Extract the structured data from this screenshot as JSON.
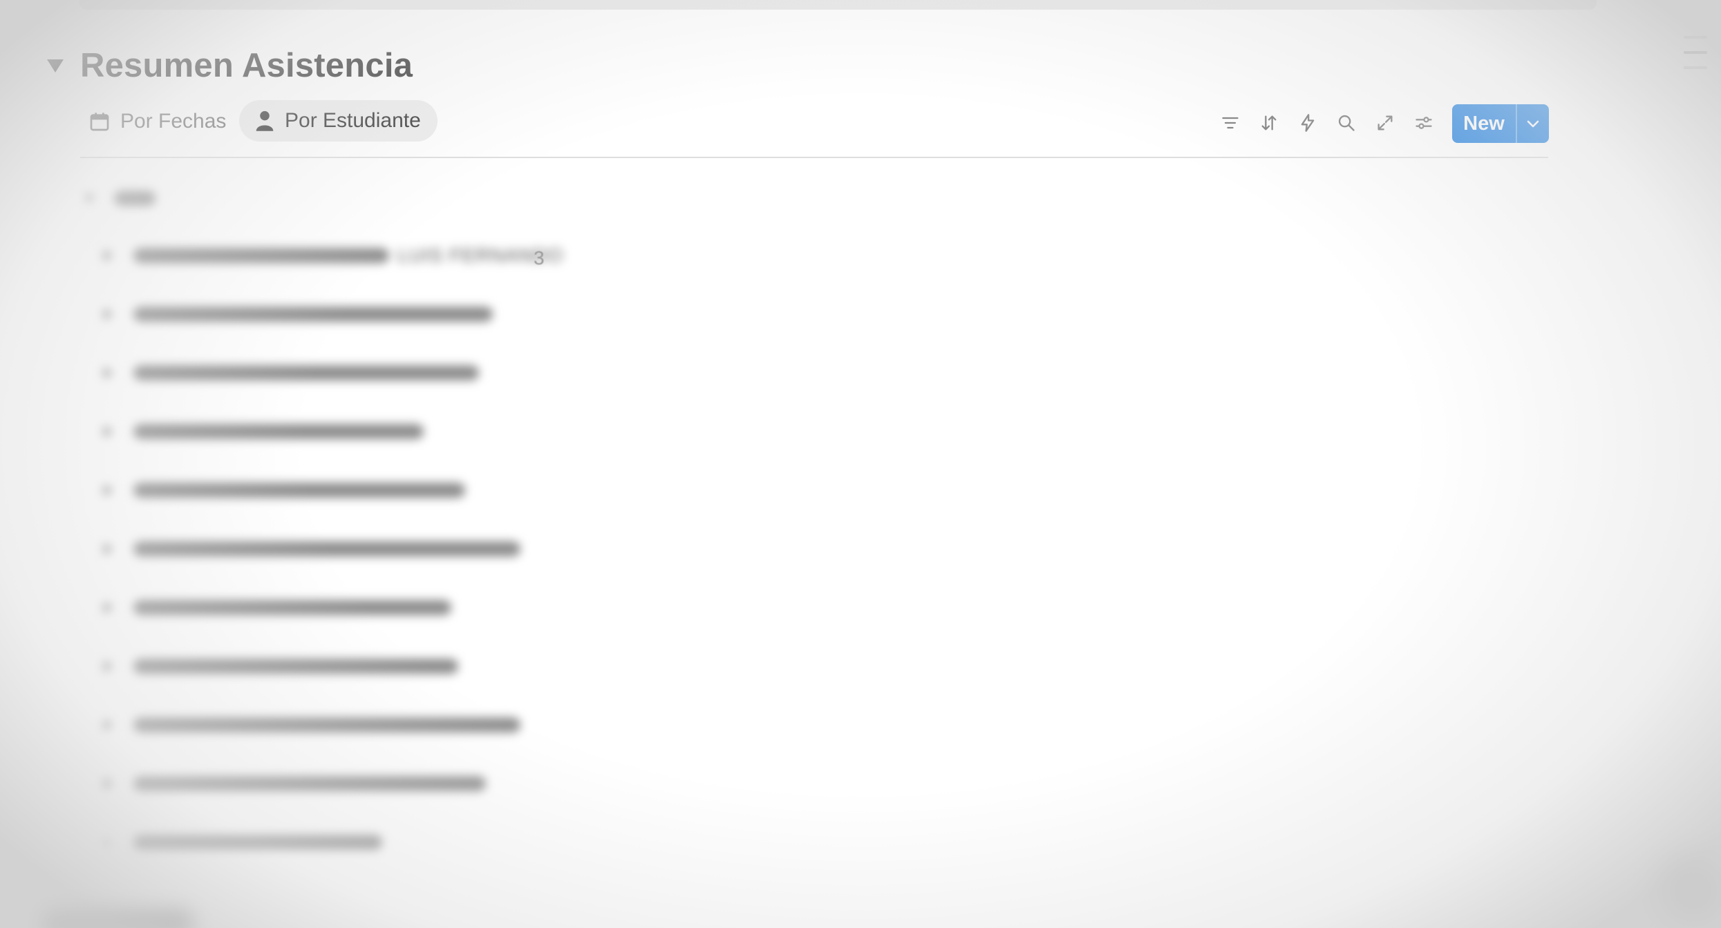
{
  "section": {
    "title": "Resumen Asistencia"
  },
  "tabs": [
    {
      "label": "Por Fechas",
      "icon": "calendar-icon",
      "active": false
    },
    {
      "label": "Por Estudiante",
      "icon": "person-icon",
      "active": true
    }
  ],
  "toolbar": {
    "icons": [
      "filter-icon",
      "sort-icon",
      "automation-icon",
      "search-icon",
      "expand-icon",
      "settings-icon"
    ],
    "new_label": "New",
    "accent": "#2383e2"
  },
  "list": {
    "first_row_text": "LUIS FERNANDO",
    "first_row_count": "3"
  }
}
